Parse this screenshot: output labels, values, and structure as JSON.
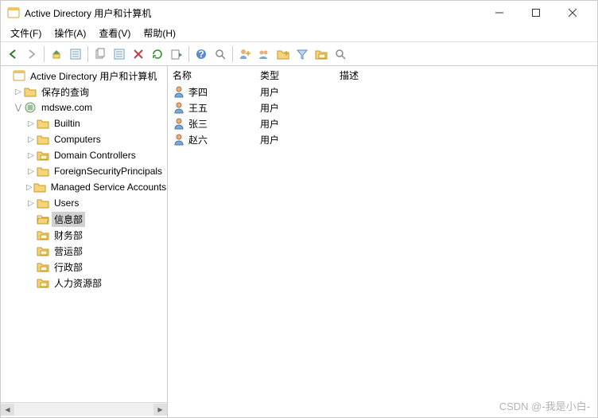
{
  "window": {
    "title": "Active Directory 用户和计算机"
  },
  "menu": {
    "file": "文件(F)",
    "action": "操作(A)",
    "view": "查看(V)",
    "help": "帮助(H)"
  },
  "tree": {
    "root": "Active Directory 用户和计算机",
    "saved_queries": "保存的查询",
    "domain": "mdswe.com",
    "builtin": "Builtin",
    "computers": "Computers",
    "domain_controllers": "Domain Controllers",
    "fsp": "ForeignSecurityPrincipals",
    "msa": "Managed Service Accounts",
    "users": "Users",
    "ou_info": "信息部",
    "ou_finance": "财务部",
    "ou_ops": "营运部",
    "ou_admin": "行政部",
    "ou_hr": "人力资源部"
  },
  "list": {
    "header": {
      "name": "名称",
      "type": "类型",
      "desc": "描述"
    },
    "rows": [
      {
        "name": "李四",
        "type": "用户",
        "desc": ""
      },
      {
        "name": "王五",
        "type": "用户",
        "desc": ""
      },
      {
        "name": "张三",
        "type": "用户",
        "desc": ""
      },
      {
        "name": "赵六",
        "type": "用户",
        "desc": ""
      }
    ]
  },
  "watermark": "CSDN @-我是小白-"
}
